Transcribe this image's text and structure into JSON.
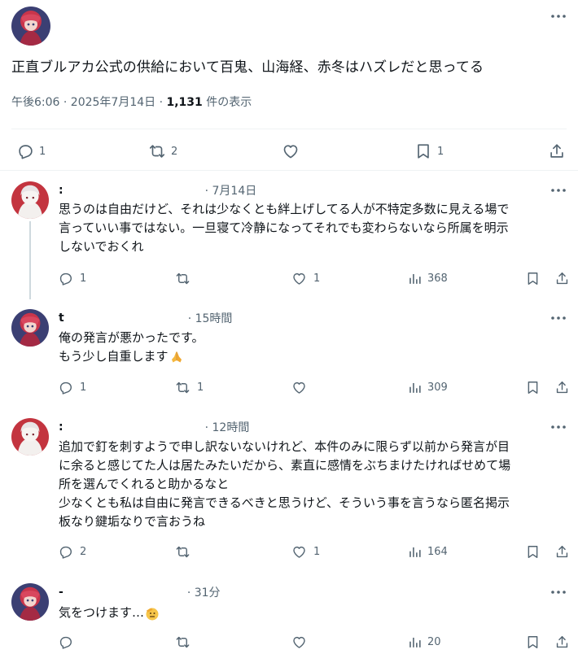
{
  "main_post": {
    "text": "正直ブルアカ公式の供給において百鬼、山海経、赤冬はハズレだと思ってる",
    "time": "午後6:06 · 2025年7月14日 · ",
    "views": "1,131",
    "views_suffix": " 件の表示",
    "replies": "1",
    "reposts": "2",
    "likes": "",
    "bookmarks": "1"
  },
  "replies": [
    {
      "name": ":",
      "time": "· 7月14日",
      "lines": [
        "思うのは自由だけど、それは少なくとも絆上げしてる人が不特定多数に見える場で",
        "言っていい事ではない。一旦寝て冷静になってそれでも変わらないなら所属を明示",
        "しないでおくれ"
      ],
      "replies": "1",
      "reposts": "",
      "likes": "1",
      "views": "368"
    },
    {
      "name": "t",
      "time": "· 15時間",
      "lines": [
        "俺の発言が悪かったです。",
        "もう少し自重します"
      ],
      "replies": "1",
      "reposts": "1",
      "likes": "",
      "views": "309"
    },
    {
      "name": ":",
      "time": "· 12時間",
      "lines": [
        "追加で釘を刺すようで申し訳ないないけれど、本件のみに限らず以前から発言が目",
        "に余ると感じてた人は居たみたいだから、素直に感情をぶちまけたければせめて場",
        "所を選んでくれると助かるなと",
        "少なくとも私は自由に発言できるべきと思うけど、そういう事を言うなら匿名掲示",
        "板なり鍵垢なりで言おうね"
      ],
      "replies": "2",
      "reposts": "",
      "likes": "1",
      "views": "164"
    },
    {
      "name": "-",
      "time": "· 31分",
      "lines": [
        "気をつけます…"
      ],
      "replies": "",
      "reposts": "",
      "likes": "",
      "views": "20"
    }
  ],
  "colors": {
    "text": "#0f1419",
    "secondary": "#536471",
    "divider": "#eff3f4",
    "thread": "#cfd9de"
  }
}
